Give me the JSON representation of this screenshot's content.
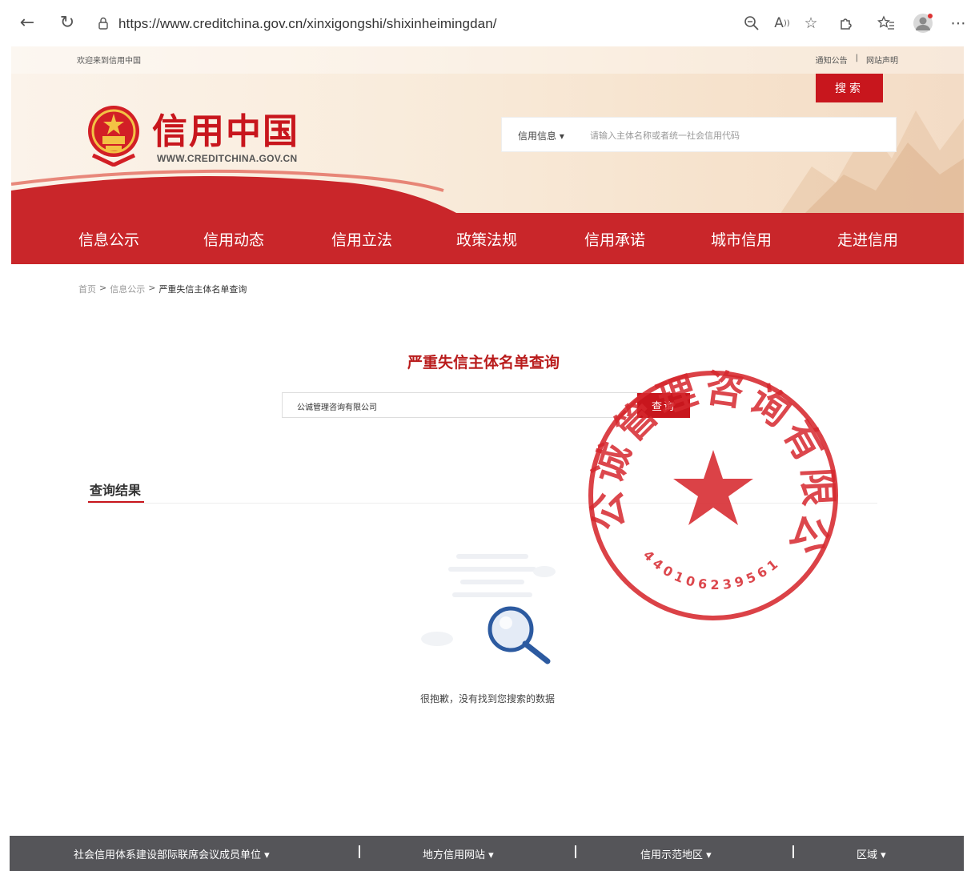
{
  "browser": {
    "url": "https://www.creditchina.gov.cn/xinxigongshi/shixinheimingdan/",
    "icons": [
      "back-icon",
      "refresh-icon",
      "lock-icon",
      "zoom-icon",
      "read-aloud-icon",
      "favorite-star-icon",
      "extensions-icon",
      "favorites-list-icon",
      "profile-avatar",
      "more-icon"
    ]
  },
  "header": {
    "welcome": "欢迎来到信用中国",
    "top_links": [
      "通知公告",
      "网站声明"
    ],
    "logo_title": "信用中国",
    "logo_url": "WWW.CREDITCHINA.GOV.CN",
    "search_category": "信用信息",
    "search_placeholder": "请输入主体名称或者统一社会信用代码",
    "search_button": "搜索"
  },
  "nav": {
    "items": [
      "信息公示",
      "信用动态",
      "信用立法",
      "政策法规",
      "信用承诺",
      "城市信用",
      "走进信用"
    ]
  },
  "breadcrumb": {
    "home": "首页",
    "section": "信息公示",
    "current": "严重失信主体名单查询",
    "separator": ">"
  },
  "query": {
    "title": "严重失信主体名单查询",
    "input_value": "公诚管理咨询有限公司",
    "button": "查询"
  },
  "results": {
    "tab_label": "查询结果",
    "empty_message": "很抱歉，没有找到您搜索的数据"
  },
  "stamp": {
    "text": "公诚管理咨询有限公司",
    "number": "4401062395610"
  },
  "footer": {
    "items": [
      "社会信用体系建设部际联席会议成员单位",
      "地方信用网站",
      "信用示范地区",
      "区域"
    ]
  },
  "colors": {
    "brand_red": "#c8161d",
    "nav_red": "#c9262a",
    "footer_gray": "#555559"
  }
}
